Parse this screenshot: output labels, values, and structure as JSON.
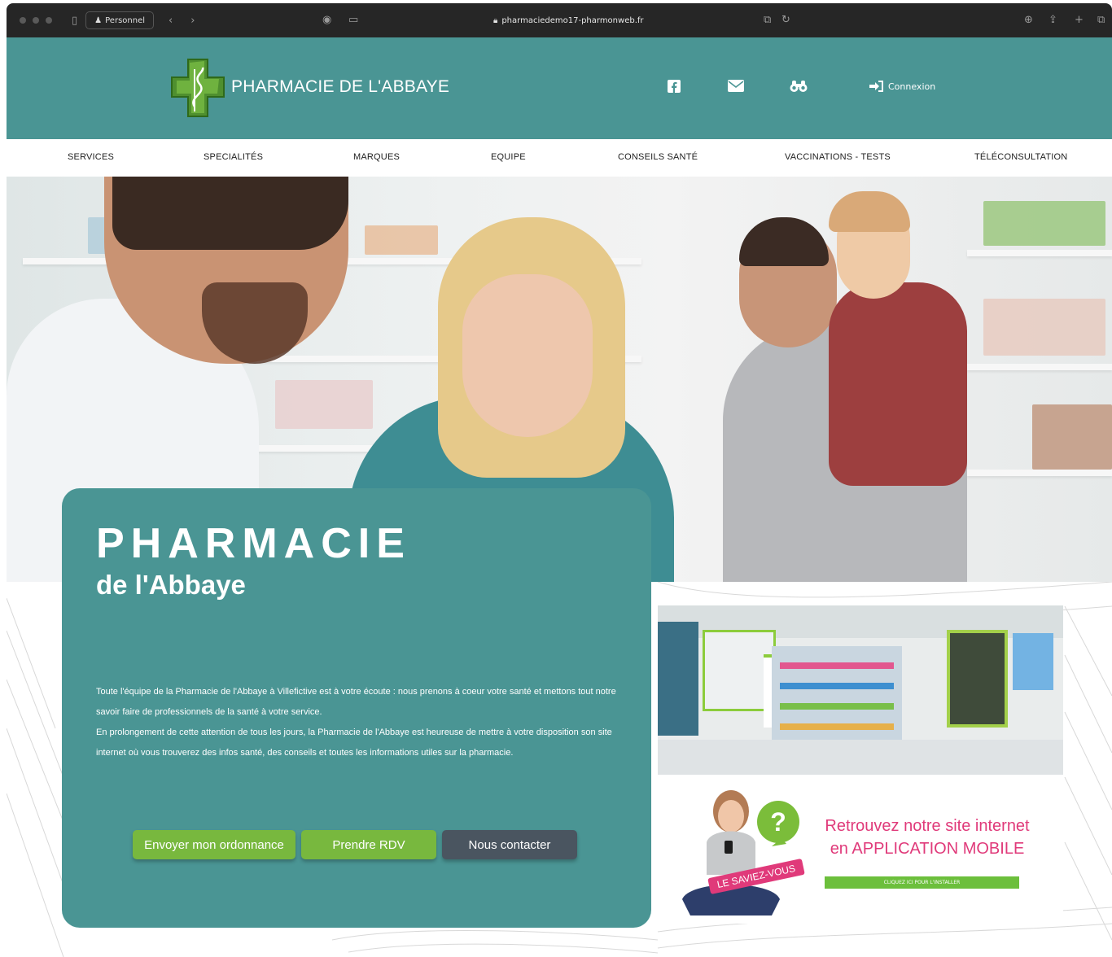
{
  "browser": {
    "profile_label": "Personnel",
    "url": "pharmaciedemo17-pharmonweb.fr"
  },
  "header": {
    "brand": "PHARMACIE DE L'ABBAYE",
    "connexion_label": "Connexion",
    "icons": [
      "facebook-icon",
      "mail-icon",
      "binoculars-icon"
    ],
    "background_color": "#4a9594"
  },
  "nav": {
    "items": [
      "SERVICES",
      "SPECIALITÉS",
      "MARQUES",
      "EQUIPE",
      "CONSEILS SANTÉ",
      "VACCINATIONS - TESTS",
      "TÉLÉCONSULTATION"
    ]
  },
  "card": {
    "title": "PHARMACIE",
    "subtitle": "de l'Abbaye",
    "paragraph_1": "Toute l'équipe de la Pharmacie de l'Abbaye à Villefictive est à votre écoute : nous prenons à coeur votre santé et mettons tout notre savoir faire de professionnels de la santé à votre service.",
    "paragraph_2": "En prolongement de cette attention de tous les jours, la Pharmacie de l'Abbaye est heureuse de mettre à votre disposition son site internet où vous trouverez des infos santé, des conseils et toutes les informations utiles sur la pharmacie.",
    "buttons": {
      "ordonnance": "Envoyer mon ordonnance",
      "rdv": "Prendre RDV",
      "contact": "Nous contacter"
    }
  },
  "promo": {
    "title_line_1": "Retrouvez notre site internet",
    "title_line_2": "en APPLICATION MOBILE",
    "bar_label": "CLIQUEZ ICI POUR L'INSTALLER",
    "badge": "LE SAVIEZ-VOUS"
  },
  "colors": {
    "teal": "#4a9594",
    "green_button": "#78b83e",
    "dark_button": "#4a5560",
    "promo_pink": "#e03a7a"
  }
}
